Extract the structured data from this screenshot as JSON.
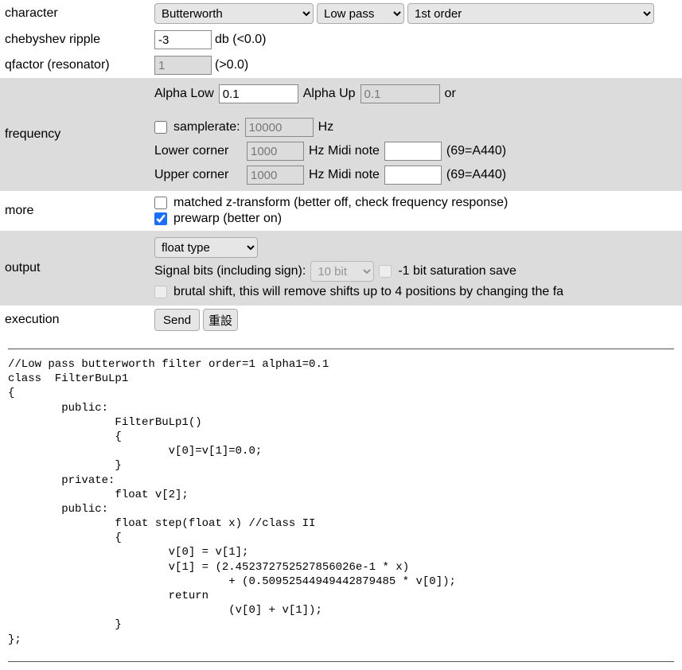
{
  "labels": {
    "character": "character",
    "chebyshev": "chebyshev ripple",
    "qfactor": "qfactor (resonator)",
    "frequency": "frequency",
    "more": "more",
    "output": "output",
    "execution": "execution"
  },
  "character": {
    "filter_family": "Butterworth",
    "pass_type": "Low pass",
    "order": "1st order"
  },
  "chebyshev": {
    "value": "-3",
    "unit": "db (<0.0)"
  },
  "qfactor": {
    "value": "1",
    "note": "(>0.0)"
  },
  "frequency": {
    "alpha_low_label": "Alpha Low",
    "alpha_low": "0.1",
    "alpha_up_label": "Alpha Up",
    "alpha_up": "0.1",
    "or": "or",
    "samplerate_label": "samplerate:",
    "samplerate": "10000",
    "hz": "Hz",
    "lower_corner_label": "Lower corner",
    "lower_corner": "1000",
    "upper_corner_label": "Upper corner",
    "upper_corner": "1000",
    "midi_label": "Hz Midi note",
    "midi_lower": "",
    "midi_upper": "",
    "midi_note": "(69=A440)"
  },
  "more": {
    "matched_z": "matched z-transform (better off, check frequency response)",
    "prewarp": "prewarp (better on)"
  },
  "output": {
    "type": "float type",
    "signal_bits_label": "Signal bits (including sign):",
    "signal_bits": "10 bit",
    "sat_save": "-1 bit saturation save",
    "brutal_shift": "brutal shift, this will remove shifts up to 4 positions by changing the fa"
  },
  "execution": {
    "send": "Send",
    "reset": "重設"
  },
  "code": "//Low pass butterworth filter order=1 alpha1=0.1\nclass  FilterBuLp1\n{\n\tpublic:\n\t\tFilterBuLp1()\n\t\t{\n\t\t\tv[0]=v[1]=0.0;\n\t\t}\n\tprivate:\n\t\tfloat v[2];\n\tpublic:\n\t\tfloat step(float x) //class II \n\t\t{\n\t\t\tv[0] = v[1];\n\t\t\tv[1] = (2.452372752527856026e-1 * x)\n\t\t\t\t + (0.50952544949442879485 * v[0]);\n\t\t\treturn \n\t\t\t\t (v[0] + v[1]);\n\t\t}\n};"
}
